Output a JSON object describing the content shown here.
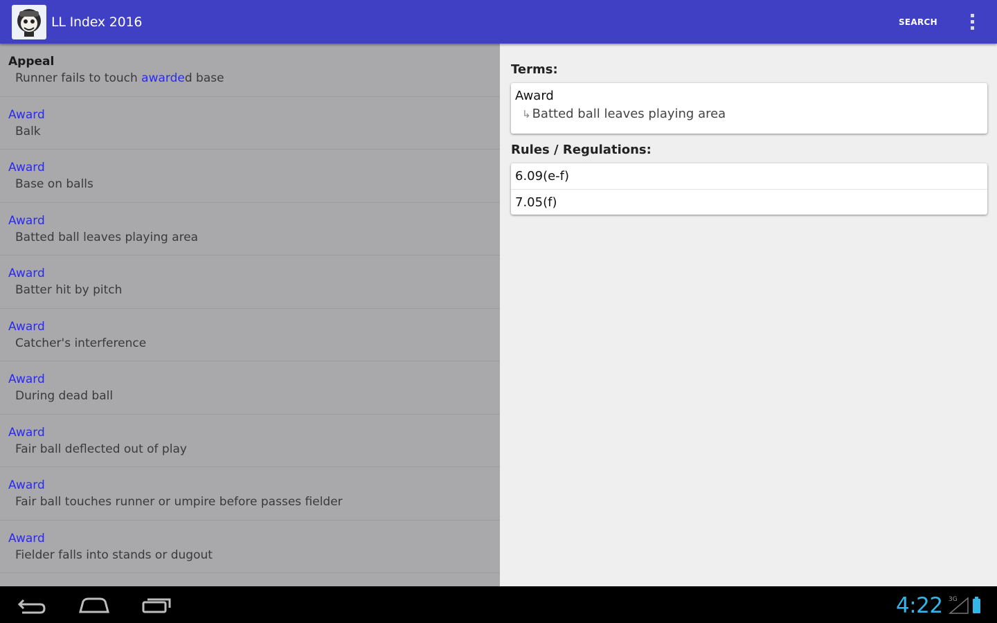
{
  "action_bar": {
    "title": "LL Index 2016",
    "search_label": "SEARCH",
    "app_icon": "monkey-logo-icon",
    "overflow_icon": "overflow-menu-icon"
  },
  "list": {
    "items": [
      {
        "term": "Appeal",
        "sub_before": "Runner fails to touch ",
        "sub_highlight": "awarde",
        "sub_after": "d base"
      },
      {
        "term": "Award",
        "sub": "Balk"
      },
      {
        "term": "Award",
        "sub": "Base on balls"
      },
      {
        "term": "Award",
        "sub": "Batted ball leaves playing area"
      },
      {
        "term": "Award",
        "sub": "Batter hit by pitch"
      },
      {
        "term": "Award",
        "sub": "Catcher's interference"
      },
      {
        "term": "Award",
        "sub": "During dead ball"
      },
      {
        "term": "Award",
        "sub": "Fair ball deflected out of play"
      },
      {
        "term": "Award",
        "sub": "Fair ball touches runner or umpire before passes fielder"
      },
      {
        "term": "Award",
        "sub": "Fielder falls into stands or dugout"
      }
    ]
  },
  "detail": {
    "terms_label": "Terms:",
    "term": "Award",
    "term_arrow": "↳",
    "term_sub": "Batted ball leaves playing area",
    "rules_label": "Rules / Regulations:",
    "rules": [
      "6.09(e-f)",
      "7.05(f)"
    ]
  },
  "system_bar": {
    "time": "4:22",
    "network_label": "3G"
  },
  "colors": {
    "action_bar": "#4040c4",
    "link_blue": "#2a2af0",
    "clock_blue": "#33b5e5",
    "list_bg": "#a9a8ab"
  }
}
